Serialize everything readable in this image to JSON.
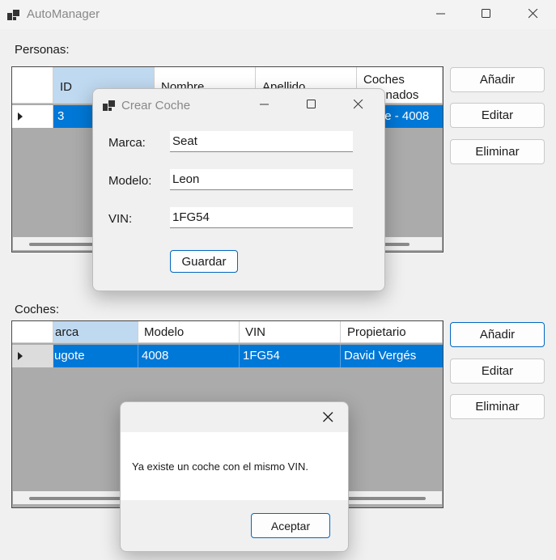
{
  "window": {
    "title": "AutoManager"
  },
  "personas": {
    "label": "Personas:",
    "columns": [
      "ID",
      "Nombre",
      "Apellido",
      "Coches\nasignados"
    ],
    "row": {
      "id": "3",
      "coches": "ugote - 4008"
    }
  },
  "coches": {
    "label": "Coches:",
    "columns": [
      "arca",
      "Modelo",
      "VIN",
      "Propietario"
    ],
    "row": {
      "marca": "ugote",
      "modelo": "4008",
      "vin": "1FG54",
      "propietario": "David Vergés"
    }
  },
  "buttons": {
    "add": "Añadir",
    "edit": "Editar",
    "delete": "Eliminar"
  },
  "crear_coche": {
    "title": "Crear Coche",
    "marca_label": "Marca:",
    "marca_value": "Seat",
    "modelo_label": "Modelo:",
    "modelo_value": "Leon",
    "vin_label": "VIN:",
    "vin_value": "1FG54",
    "save": "Guardar"
  },
  "message": {
    "text": "Ya existe un coche con el mismo VIN.",
    "ok": "Aceptar"
  }
}
